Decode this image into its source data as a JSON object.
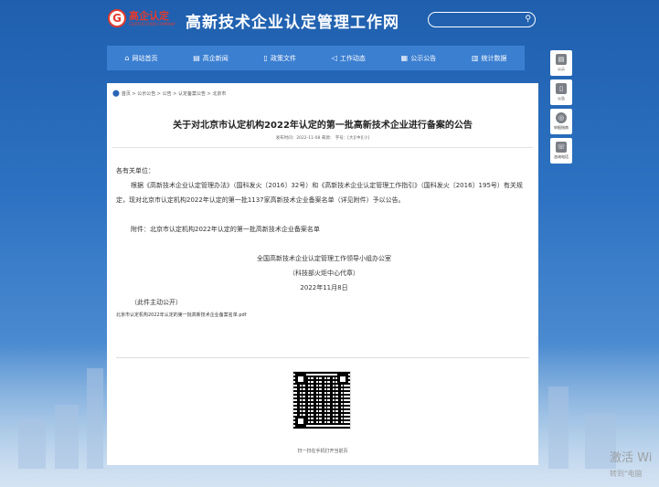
{
  "header": {
    "logo_cn": "高企认定",
    "logo_en": "CERTIFICATION COMPANY",
    "site_title": "高新技术企业认定管理工作网",
    "search_placeholder": ""
  },
  "nav": {
    "items": [
      {
        "icon": "home-icon",
        "label": "网站首页"
      },
      {
        "icon": "news-icon",
        "label": "高企新闻"
      },
      {
        "icon": "document-icon",
        "label": "政策文件"
      },
      {
        "icon": "send-icon",
        "label": "工作动态"
      },
      {
        "icon": "calendar-icon",
        "label": "公示公告"
      },
      {
        "icon": "chart-icon",
        "label": "统计数据"
      }
    ]
  },
  "side": {
    "items": [
      {
        "icon": "notice-icon",
        "label": "公示"
      },
      {
        "icon": "announcement-icon",
        "label": "公告"
      },
      {
        "icon": "compass-icon",
        "label": "申报指南"
      },
      {
        "icon": "phone-icon",
        "label": "咨询电话"
      }
    ]
  },
  "breadcrumb": "首页 > 公示公告 > 公告 > 认定备案公告 > 北京市",
  "article": {
    "title": "关于对北京市认定机构2022年认定的第一批高新技术企业进行备案的公告",
    "meta": "发布时间：2022-11-08 来源：       字号：[大][中][小]",
    "salutation": "各有关单位：",
    "paragraph": "根据《高新技术企业认定管理办法》（国科发火〔2016〕32号）和《高新技术企业认定管理工作指引》（国科发火〔2016〕195号）有关规定，现对北京市认定机构2022年认定的第一批1137家高新技术企业备案名单（详见附件）予以公告。",
    "attachment": "附件：北京市认定机构2022年认定的第一批高新技术企业备案名单",
    "signature_org": "全国高新技术企业认定管理工作领导小组办公室",
    "signature_sub": "（科技部火炬中心代章）",
    "date": "2022年11月8日",
    "public_note": "（此件主动公开）",
    "file_link": "北京市认定机构2022年认定的第一批高新技术企业备案名单.pdf",
    "qr_caption": "扫一扫在手机打开当前页"
  },
  "watermark": {
    "line1": "激活 Wi",
    "line2": "转到\"电脑"
  }
}
